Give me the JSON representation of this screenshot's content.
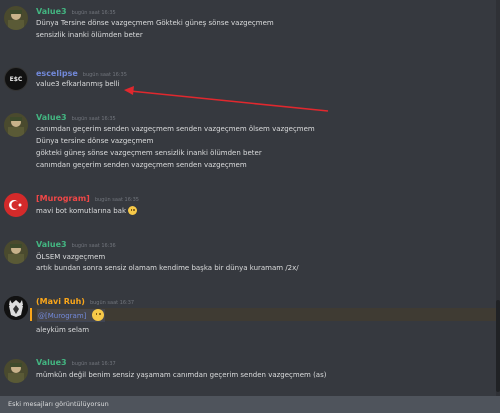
{
  "colors": {
    "background": "#36393f",
    "value3": "#43b581",
    "escelipse": "#7289da",
    "murogram": "#f04747",
    "mavi_ruh": "#faa61a",
    "arrow": "#e0282e"
  },
  "messages": [
    {
      "user": "Value3",
      "time": "bugün saat 16:35",
      "lines": [
        "Dünya Tersine dönse vazgeçmem Gökteki güneş sönse vazgeçmem",
        "sensizlik inanki ölümden beter"
      ]
    },
    {
      "user": "escelipse",
      "time": "bugün saat 16:35",
      "avatar_text": "E$C",
      "lines": [
        "value3 efkarlanmış belli"
      ]
    },
    {
      "user": "Value3",
      "time": "bugün saat 16:35",
      "lines": [
        "canımdan geçerim senden vazgeçmem senden vazgeçmem ölsem vazgeçmem",
        "Dünya tersine dönse vazgeçmem",
        "gökteki güneş sönse vazgeçmem sensizlik inanki ölümden beter",
        "canımdan geçerim senden vazgeçmem senden vazgeçmem"
      ]
    },
    {
      "user": "[Murogram]",
      "time": "bugün saat 16:35",
      "lines": [
        "mavi bot komutlarına bak"
      ],
      "emoji": "slight-smile-emoji"
    },
    {
      "user": "Value3",
      "time": "bugün saat 16:36",
      "lines": [
        "ÖLSEM vazgeçmem",
        "artık bundan sonra sensiz olamam kendime  başka bir dünya kuramam  /2x/"
      ]
    },
    {
      "user": "(Mavi Ruh)",
      "time": "bugün saat 16:37",
      "mention": "@[Murogram]",
      "mention_emoji": "confused-emoji",
      "lines": [
        "aleyküm selam"
      ]
    },
    {
      "user": "Value3",
      "time": "bugün saat 16:37",
      "lines": [
        "mümkün değil benim sensiz yaşamam canımdan geçerim senden vazgeçmem (as)"
      ]
    }
  ],
  "status_bar": {
    "text": "Eski mesajları görüntülüyorsun"
  }
}
